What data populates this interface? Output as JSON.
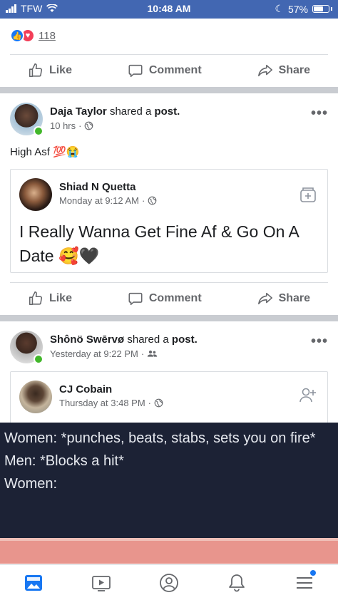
{
  "status_bar": {
    "carrier": "TFW",
    "time": "10:48 AM",
    "battery": "57%"
  },
  "top_post": {
    "reaction_count": "118"
  },
  "actions": {
    "like": "Like",
    "comment": "Comment",
    "share": "Share"
  },
  "post1": {
    "author": "Daja Taylor",
    "shared_text": "shared a",
    "shared_type": "post.",
    "time": "10 hrs",
    "text": "High Asf 💯😭",
    "shared": {
      "author": "Shiad N Quetta",
      "time": "Monday at 9:12 AM",
      "text": "I Really Wanna Get Fine Af & Go On A Date 🥰🖤"
    }
  },
  "post2": {
    "author": "Shônö Swērvø",
    "shared_text": "shared a",
    "shared_type": "post.",
    "time": "Yesterday at 9:22 PM",
    "shared": {
      "author": "CJ Cobain",
      "time": "Thursday at 3:48 PM"
    },
    "meme_lines": [
      "Women: *punches, beats, stabs, sets you on fire*",
      "Men: *Blocks a hit*",
      "Women:"
    ]
  },
  "colors": {
    "brand": "#4267b2",
    "like_blue": "#1877f2",
    "online_green": "#42b72a"
  }
}
